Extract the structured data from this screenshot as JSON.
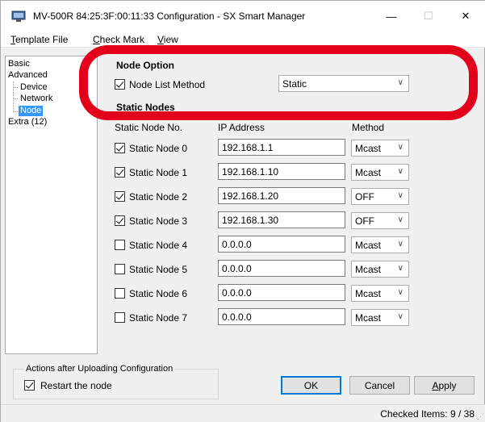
{
  "window": {
    "title": "MV-500R 84:25:3F:00:11:33 Configuration - SX Smart Manager",
    "minimize": "—",
    "maximize": "☐",
    "close": "✕"
  },
  "menu": {
    "template_file_first": "T",
    "template_file_rest": "emplate File",
    "check_mark_first": "C",
    "check_mark_rest": "heck Mark",
    "view_first": "V",
    "view_rest": "iew"
  },
  "tree": {
    "basic": "Basic",
    "advanced": "Advanced",
    "device": "Device",
    "network": "Network",
    "node": "Node",
    "extra": "Extra (12)"
  },
  "node_option": {
    "title": "Node Option",
    "list_method_label": "Node List Method",
    "list_method_checked": true,
    "list_method_value": "Static"
  },
  "static_nodes": {
    "title": "Static Nodes",
    "col_no": "Static Node No.",
    "col_ip": "IP Address",
    "col_method": "Method",
    "rows": [
      {
        "label": "Static Node 0",
        "checked": true,
        "ip": "192.168.1.1",
        "method": "Mcast"
      },
      {
        "label": "Static Node 1",
        "checked": true,
        "ip": "192.168.1.10",
        "method": "Mcast"
      },
      {
        "label": "Static Node 2",
        "checked": true,
        "ip": "192.168.1.20",
        "method": "OFF"
      },
      {
        "label": "Static Node 3",
        "checked": true,
        "ip": "192.168.1.30",
        "method": "OFF"
      },
      {
        "label": "Static Node 4",
        "checked": false,
        "ip": "0.0.0.0",
        "method": "Mcast"
      },
      {
        "label": "Static Node 5",
        "checked": false,
        "ip": "0.0.0.0",
        "method": "Mcast"
      },
      {
        "label": "Static Node 6",
        "checked": false,
        "ip": "0.0.0.0",
        "method": "Mcast"
      },
      {
        "label": "Static Node 7",
        "checked": false,
        "ip": "0.0.0.0",
        "method": "Mcast"
      }
    ]
  },
  "actions": {
    "group_label": "Actions after Uploading Configuration",
    "restart_label": "Restart the node",
    "restart_checked": true
  },
  "buttons": {
    "ok": "OK",
    "cancel": "Cancel",
    "apply": "Apply"
  },
  "status": {
    "checked_items": "Checked Items: 9 / 38"
  },
  "colors": {
    "highlight": "#e3001b",
    "selection": "#3399ff"
  }
}
